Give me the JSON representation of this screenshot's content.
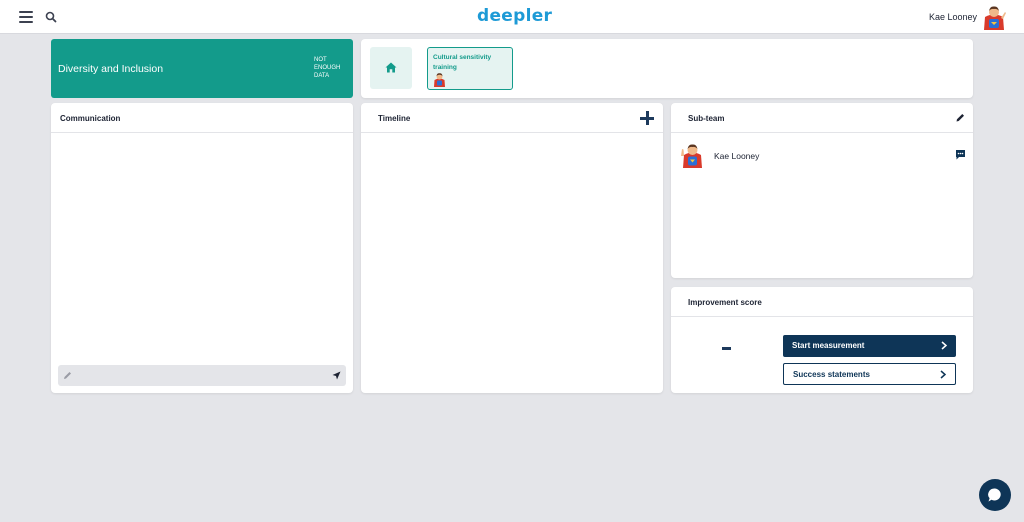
{
  "app": {
    "logo": "deepler"
  },
  "header": {
    "user_name": "Kae Looney"
  },
  "team": {
    "title": "Diversity and Inclusion",
    "status": "NOT ENOUGH DATA"
  },
  "breadcrumb": {
    "current": "Cultural sensitivity training"
  },
  "communication": {
    "title": "Communication",
    "input_placeholder": ""
  },
  "timeline": {
    "title": "Timeline"
  },
  "subteam": {
    "title": "Sub-team",
    "members": [
      {
        "name": "Kae Looney"
      }
    ]
  },
  "improvement": {
    "title": "Improvement score",
    "score": "-",
    "start_label": "Start measurement",
    "success_label": "Success statements"
  },
  "icons": {
    "menu": "hamburger-icon",
    "search": "search-icon",
    "home": "home-icon",
    "pencil": "pencil-icon",
    "send": "send-icon",
    "plus": "plus-icon",
    "edit": "edit-icon",
    "chat": "chat-icon",
    "chevron": "chevron-right-icon",
    "fab": "chat-bubble-icon"
  },
  "colors": {
    "brand": "#1d9ad6",
    "team_card": "#139b8b",
    "primary": "#0e3557",
    "background": "#e4e5e9"
  }
}
